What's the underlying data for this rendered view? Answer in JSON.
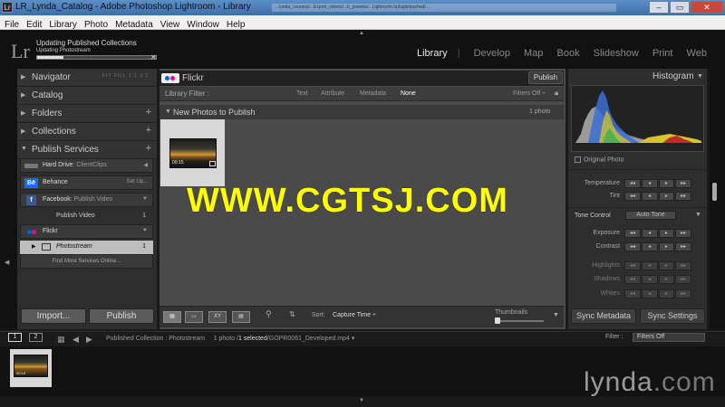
{
  "window": {
    "title": "LR_Lynda_Catalog - Adobe Photoshop Lightroom - Library",
    "app_icon": "Lr",
    "address_hint": "...lynda_courses/...Export_videos/...lr_presets/...Lightroom.lrplugin/pushed/...",
    "min_label": "–",
    "max_label": "▭",
    "close_label": "✕"
  },
  "menu": [
    "File",
    "Edit",
    "Library",
    "Photo",
    "Metadata",
    "View",
    "Window",
    "Help"
  ],
  "header": {
    "logo": "Lr",
    "progress_title": "Updating Published Collections",
    "progress_sub": "Updating Photostream",
    "progress_fraction": 0.22,
    "progress_close": "✕",
    "modules": [
      "Library",
      "Develop",
      "Map",
      "Book",
      "Slideshow",
      "Print",
      "Web"
    ],
    "active_module": "Library",
    "separator": "|"
  },
  "left": {
    "navigator": "Navigator",
    "nav_options": "FIT  FILL  1:1  3:1",
    "catalog": "Catalog",
    "folders": "Folders",
    "collections": "Collections",
    "publish_services": "Publish Services",
    "services": {
      "hard_drive": {
        "name": "Hard Drive",
        "sub": ": ClientClips"
      },
      "behance": {
        "name": "Behance",
        "action": "Set Up..."
      },
      "facebook": {
        "name": "Facebook",
        "sub": ": Publish Video",
        "child": "Publish Video",
        "child_count": "1"
      },
      "flickr": {
        "name": "Flickr",
        "child": "Photostream",
        "child_count": "1"
      }
    },
    "find_more": "Find More Services Online...",
    "import_btn": "Import...",
    "publish_btn": "Publish"
  },
  "center": {
    "collection_title": "Flickr",
    "publish_btn": "Publish",
    "filter_label": "Library Filter :",
    "filter_options": [
      "Text",
      "Attribute",
      "Metadata",
      "None"
    ],
    "filter_active": "None",
    "filters_off": "Filters Off ÷",
    "section_title": "New Photos to Publish",
    "section_count": "1 photo",
    "thumb_caption": "00:15",
    "watermark": "WWW.CGTSJ.COM",
    "sort_label": "Sort:",
    "sort_value": "Capture Time ÷",
    "thumbs_label": "Thumbnails"
  },
  "right": {
    "histogram_title": "Histogram",
    "original_photo": "Original Photo",
    "quick_rows": [
      {
        "label": "Temperature",
        "dim": false
      },
      {
        "label": "Tint",
        "dim": false
      }
    ],
    "tone_control": "Tone Control",
    "auto_tone": "Auto Tone",
    "tone_rows": [
      {
        "label": "Exposure",
        "dim": false
      },
      {
        "label": "Contrast",
        "dim": false
      },
      {
        "label": "Highlights",
        "dim": true
      },
      {
        "label": "Shadows",
        "dim": true
      },
      {
        "label": "Whites",
        "dim": true
      }
    ],
    "sync_metadata": "Sync Metadata",
    "sync_settings": "Sync Settings"
  },
  "filmstrip": {
    "page1": "1",
    "page2": "2",
    "breadcrumb_source": "Published Collection : Photostream",
    "breadcrumb_count": "1 photo /",
    "breadcrumb_selected": "1 selected",
    "breadcrumb_file": "/GOPR0061_Developed.mp4 ▾",
    "filter_label": "Filter :",
    "filter_value": "Filters Off",
    "thumb_caption": "00:15"
  },
  "branding": {
    "lynda": "lynda",
    "lynda_tld": ".com"
  },
  "colors": {
    "accent_flickr_blue": "#0063dc",
    "accent_flickr_pink": "#ff0084",
    "watermark_yellow": "#ffff00",
    "facebook_blue": "#3b5998",
    "behance_blue": "#1769ff"
  }
}
